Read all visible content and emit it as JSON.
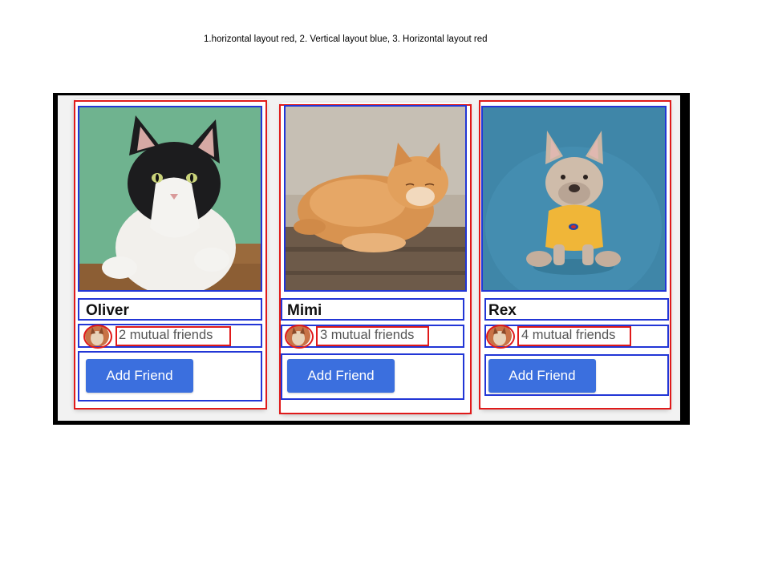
{
  "caption": "1.horizontal layout red, 2. Vertical layout blue, 3. Horizontal layout red",
  "cards": [
    {
      "name": "Oliver",
      "mutual": "2 mutual friends",
      "button": "Add Friend",
      "photo": "black-white-cat-photo"
    },
    {
      "name": "Mimi",
      "mutual": "3 mutual friends",
      "button": "Add Friend",
      "photo": "orange-tabby-cat-photo"
    },
    {
      "name": "Rex",
      "mutual": "4 mutual friends",
      "button": "Add Friend",
      "photo": "french-bulldog-photo"
    }
  ],
  "colors": {
    "annotation_red": "#e01a1a",
    "annotation_blue": "#2236d6",
    "button": "#3b6fde",
    "frame": "#000000"
  }
}
